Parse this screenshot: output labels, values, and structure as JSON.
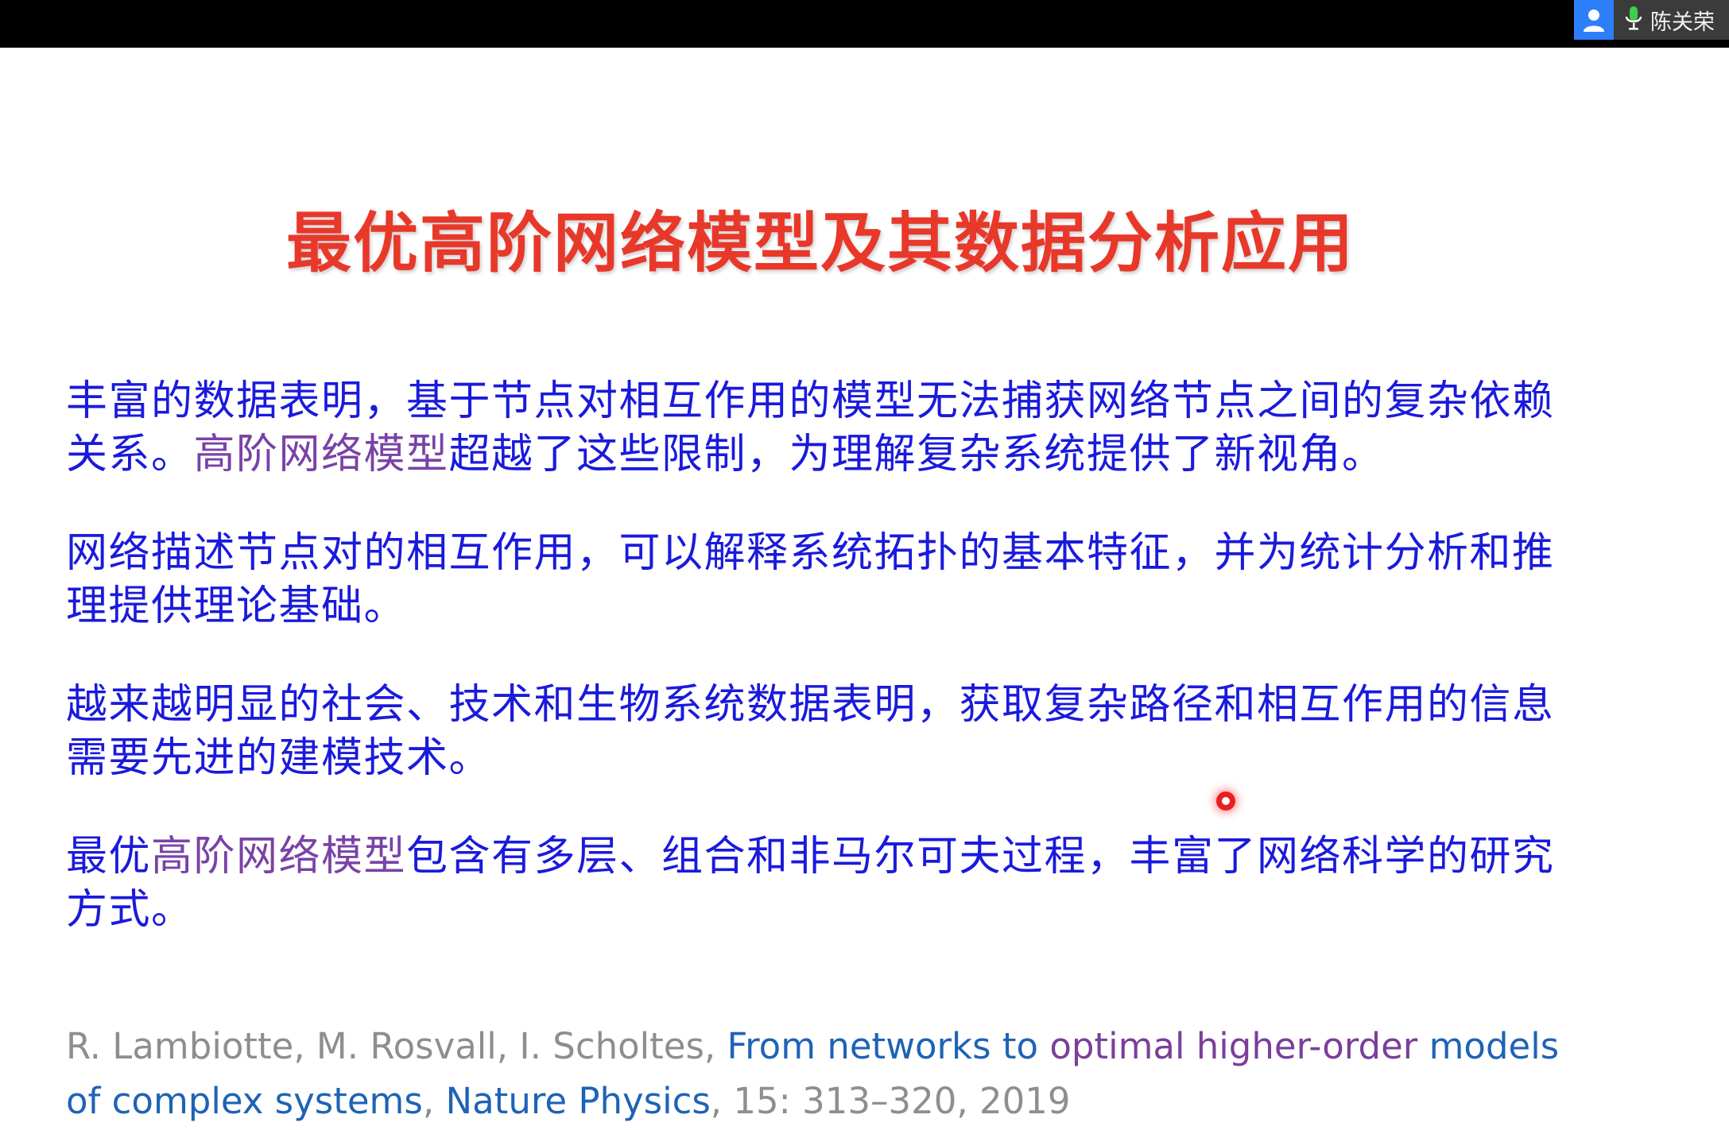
{
  "meeting_bar": {
    "speaker_name": "陈关荣",
    "avatar_icon": "user-icon",
    "mic_icon": "microphone-icon",
    "avatar_color": "#2d7ff9"
  },
  "slide": {
    "title": "最优高阶网络模型及其数据分析应用",
    "title_color": "#e8382a",
    "body_color": "#1a1adc",
    "highlight_color": "#7a42a6",
    "paragraphs": [
      {
        "before": "丰富的数据表明，基于节点对相互作用的模型无法捕获网络节点之间的复杂依赖关系。",
        "highlight": "高阶网络模型",
        "after": "超越了这些限制，为理解复杂系统提供了新视角。"
      },
      {
        "text": "网络描述节点对的相互作用，可以解释系统拓扑的基本特征，并为统计分析和推理提供理论基础。"
      },
      {
        "text": "越来越明显的社会、技术和生物系统数据表明，获取复杂路径和相互作用的信息需要先进的建模技术。"
      },
      {
        "before": "最优",
        "highlight": "高阶网络模型",
        "after": "包含有多层、组合和非马尔可夫过程，丰富了网络科学的研究方式。"
      }
    ],
    "citation": {
      "authors": "R. Lambiotte, M. Rosvall, I. Scholtes, ",
      "title_part1": "From networks to ",
      "title_part2": "optimal higher-order",
      "title_part3": " models of complex systems",
      "comma": ", ",
      "journal": "Nature Physics",
      "details": ", 15: 313–320, 2019"
    }
  }
}
